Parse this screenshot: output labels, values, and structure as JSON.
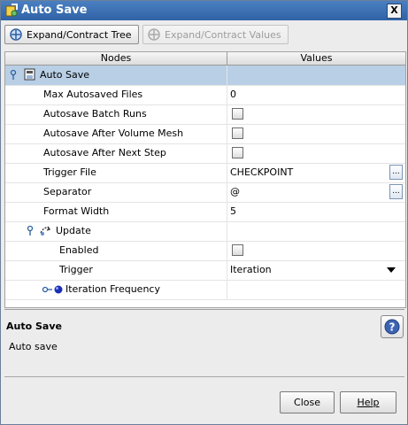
{
  "window": {
    "title": "Auto Save",
    "close_glyph": "X"
  },
  "toolbar": {
    "expand_tree_label": "Expand/Contract Tree",
    "expand_values_label": "Expand/Contract Values"
  },
  "table": {
    "columns": [
      "Nodes",
      "Values"
    ],
    "root": {
      "label": "Auto Save"
    },
    "rows": {
      "max_files": {
        "label": "Max Autosaved Files",
        "value": "0"
      },
      "batch_runs": {
        "label": "Autosave Batch Runs",
        "checked": false
      },
      "after_volume_mesh": {
        "label": "Autosave After Volume Mesh",
        "checked": false
      },
      "after_next_step": {
        "label": "Autosave After Next Step",
        "checked": false
      },
      "trigger_file": {
        "label": "Trigger File",
        "value": "CHECKPOINT",
        "button": "..."
      },
      "separator": {
        "label": "Separator",
        "value": "@",
        "button": "..."
      },
      "format_width": {
        "label": "Format Width",
        "value": "5"
      },
      "update": {
        "label": "Update"
      },
      "enabled": {
        "label": "Enabled",
        "checked": false
      },
      "trigger": {
        "label": "Trigger",
        "value": "Iteration"
      },
      "iteration_frequency": {
        "label": "Iteration Frequency"
      }
    }
  },
  "description": {
    "title": "Auto Save",
    "text": "Auto save"
  },
  "buttons": {
    "close": "Close",
    "help": "Help"
  },
  "colors": {
    "title_bar": "#2f63a6",
    "selected_row": "#b8cfe5",
    "window_bg": "#ececec"
  }
}
